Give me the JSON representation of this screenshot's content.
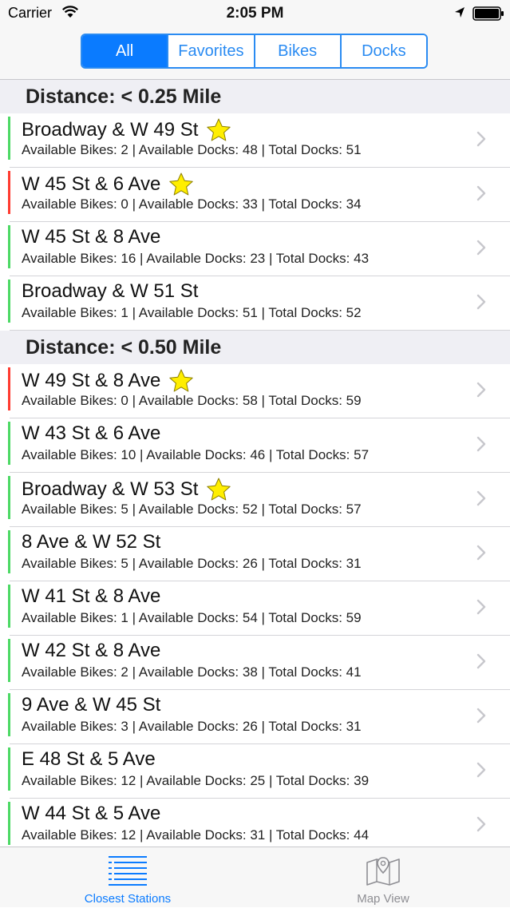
{
  "status_bar": {
    "carrier": "Carrier",
    "time": "2:05 PM"
  },
  "segments": [
    {
      "label": "All",
      "active": true
    },
    {
      "label": "Favorites",
      "active": false
    },
    {
      "label": "Bikes",
      "active": false
    },
    {
      "label": "Docks",
      "active": false
    }
  ],
  "colors": {
    "accent": "#0a7bff",
    "available": "#4cd964",
    "empty": "#ff3b30",
    "star": "#ffee00"
  },
  "sections": [
    {
      "header": "Distance: < 0.25 Mile",
      "stations": [
        {
          "name": "Broadway & W 49 St",
          "favorite": true,
          "status": "available",
          "detail": "Available Bikes: 2 | Available Docks: 48 | Total Docks: 51"
        },
        {
          "name": "W 45 St & 6 Ave",
          "favorite": true,
          "status": "empty",
          "detail": "Available Bikes: 0 | Available Docks: 33 | Total Docks: 34"
        },
        {
          "name": "W 45 St & 8 Ave",
          "favorite": false,
          "status": "available",
          "detail": "Available Bikes: 16 | Available Docks: 23 | Total Docks: 43"
        },
        {
          "name": "Broadway & W 51 St",
          "favorite": false,
          "status": "available",
          "detail": "Available Bikes: 1 | Available Docks: 51 | Total Docks: 52"
        }
      ]
    },
    {
      "header": "Distance: < 0.50 Mile",
      "stations": [
        {
          "name": "W 49 St & 8 Ave",
          "favorite": true,
          "status": "empty",
          "detail": "Available Bikes: 0 | Available Docks: 58 | Total Docks: 59"
        },
        {
          "name": "W 43 St & 6 Ave",
          "favorite": false,
          "status": "available",
          "detail": "Available Bikes: 10 | Available Docks: 46 | Total Docks: 57"
        },
        {
          "name": "Broadway & W 53 St",
          "favorite": true,
          "status": "available",
          "detail": "Available Bikes: 5 | Available Docks: 52 | Total Docks: 57"
        },
        {
          "name": "8 Ave & W 52 St",
          "favorite": false,
          "status": "available",
          "detail": "Available Bikes: 5 | Available Docks: 26 | Total Docks: 31"
        },
        {
          "name": "W 41 St & 8 Ave",
          "favorite": false,
          "status": "available",
          "detail": "Available Bikes: 1 | Available Docks: 54 | Total Docks: 59"
        },
        {
          "name": "W 42 St & 8 Ave",
          "favorite": false,
          "status": "available",
          "detail": "Available Bikes: 2 | Available Docks: 38 | Total Docks: 41"
        },
        {
          "name": "9 Ave & W 45 St",
          "favorite": false,
          "status": "available",
          "detail": "Available Bikes: 3 | Available Docks: 26 | Total Docks: 31"
        },
        {
          "name": "E 48 St & 5 Ave",
          "favorite": false,
          "status": "available",
          "detail": "Available Bikes: 12 | Available Docks: 25 | Total Docks: 39"
        },
        {
          "name": "W 44 St & 5 Ave",
          "favorite": false,
          "status": "available",
          "detail": "Available Bikes: 12 | Available Docks: 31 | Total Docks: 44"
        }
      ]
    }
  ],
  "tab_bar": {
    "tabs": [
      {
        "label": "Closest Stations",
        "icon": "list-icon",
        "active": true
      },
      {
        "label": "Map View",
        "icon": "map-icon",
        "active": false
      }
    ]
  }
}
